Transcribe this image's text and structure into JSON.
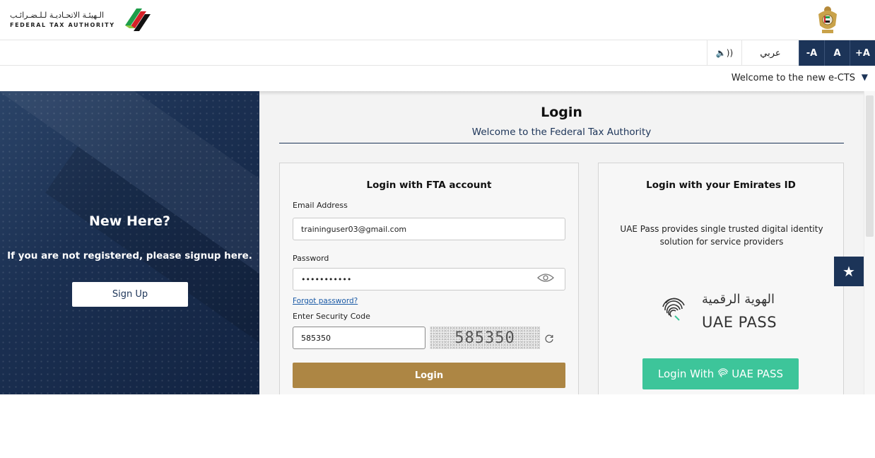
{
  "header": {
    "logo_ar": "الـهيئـة الاتحـاديـة لـلـضـرائـب",
    "logo_en": "FEDERAL TAX AUTHORITY",
    "logo_icon": "fta-logo-icon",
    "emblem_icon": "uae-emblem-icon"
  },
  "toolbar": {
    "sound_label": "🔈))",
    "language_label": "عربي",
    "font_decrease": "-A",
    "font_reset": "A",
    "font_increase": "+A"
  },
  "ticker": {
    "text": "Welcome to the new e-CTS",
    "arrow": "▼"
  },
  "left_panel": {
    "title": "New Here?",
    "hint": "If you are not registered, please signup here.",
    "signup_label": "Sign Up"
  },
  "main": {
    "title": "Login",
    "subtitle": "Welcome to the Federal Tax Authority"
  },
  "fta_login": {
    "title": "Login with FTA account",
    "email_label": "Email Address",
    "email_value": "traininguser03@gmail.com",
    "password_label": "Password",
    "password_value": "•••••••••••",
    "forgot_label": "Forgot password?",
    "security_label": "Enter Security Code",
    "security_value": "585350",
    "captcha_text": "585350",
    "login_label": "Login"
  },
  "eid_login": {
    "title": "Login with your Emirates ID",
    "description": "UAE Pass provides single trusted digital identity solution for service providers",
    "logo_ar": "الهوية الرقمية",
    "logo_en": "UAE PASS",
    "button_prefix": "Login With",
    "button_brand": "UAE PASS"
  },
  "favorite": {
    "icon": "★"
  },
  "colors": {
    "navy": "#1c3458",
    "gold": "#ad8644",
    "uaepass_green": "#3dc59a",
    "link": "#1a5aa6"
  }
}
